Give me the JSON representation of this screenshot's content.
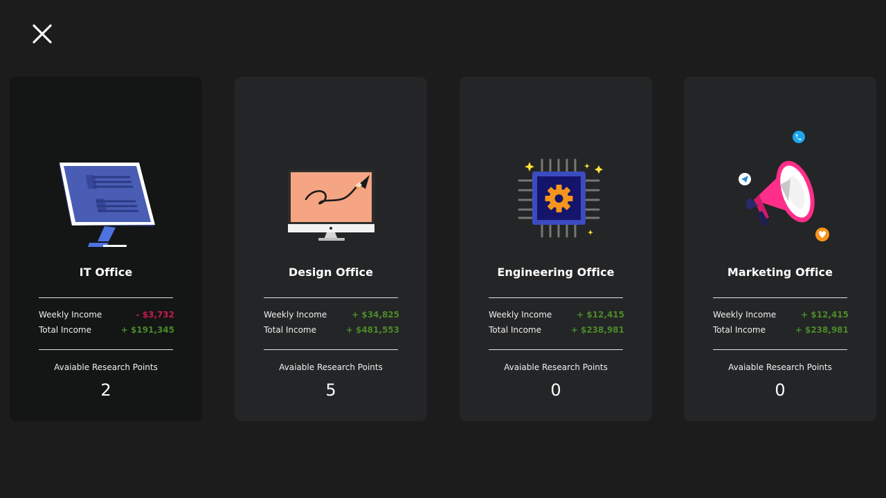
{
  "close_icon": "close-icon",
  "colors": {
    "background": "#1c1c1c",
    "card": "#242526",
    "card_selected": "#141515",
    "negative": "#c51d4b",
    "positive": "#4b8a2a"
  },
  "offices": [
    {
      "title": "IT Office",
      "icon": "monitor-icon",
      "selected": true,
      "weekly_income_label": "Weekly Income",
      "weekly_income": "- $3,732",
      "weekly_income_sign": "negative",
      "total_income_label": "Total Income",
      "total_income": "+ $191,345",
      "research_label": "Avaiable Research Points",
      "research_points": "2"
    },
    {
      "title": "Design Office",
      "icon": "design-monitor-icon",
      "selected": false,
      "weekly_income_label": "Weekly Income",
      "weekly_income": "+ $34,825",
      "weekly_income_sign": "positive",
      "total_income_label": "Total Income",
      "total_income": "+ $481,553",
      "research_label": "Avaiable Research Points",
      "research_points": "5"
    },
    {
      "title": "Engineering Office",
      "icon": "chip-gear-icon",
      "selected": false,
      "weekly_income_label": "Weekly Income",
      "weekly_income": "+ $12,415",
      "weekly_income_sign": "positive",
      "total_income_label": "Total Income",
      "total_income": "+ $238,981",
      "research_label": "Avaiable Research Points",
      "research_points": "0"
    },
    {
      "title": "Marketing Office",
      "icon": "megaphone-icon",
      "selected": false,
      "weekly_income_label": "Weekly Income",
      "weekly_income": "+ $12,415",
      "weekly_income_sign": "positive",
      "total_income_label": "Total Income",
      "total_income": "+ $238,981",
      "research_label": "Avaiable Research Points",
      "research_points": "0"
    }
  ]
}
